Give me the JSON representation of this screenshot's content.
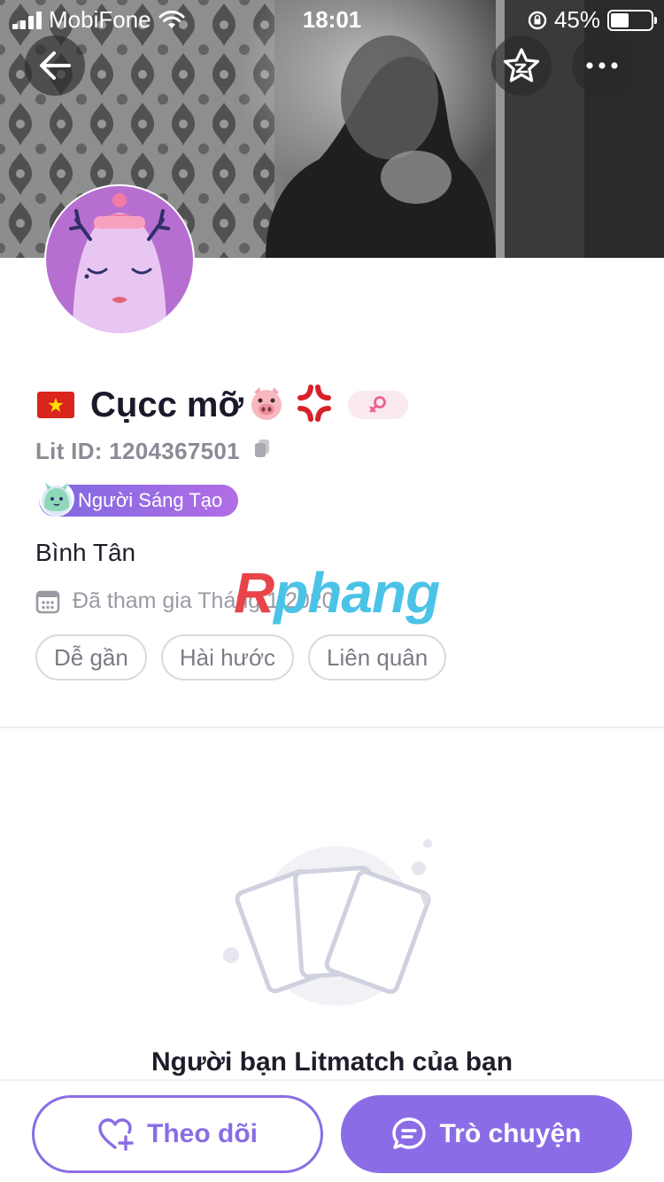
{
  "status_bar": {
    "carrier": "MobiFone",
    "time": "18:01",
    "battery": "45%",
    "battery_level": 0.45
  },
  "header": {
    "back_icon": "arrow-left-icon",
    "favorite_icon": "star-icon",
    "more_icon": "more-horizontal-icon"
  },
  "profile": {
    "flag_icon": "vietnam-flag-icon",
    "name": "Cụcc mỡ",
    "name_emojis": [
      "🐷",
      "💢"
    ],
    "gender_icon": "female-symbol-icon",
    "lit_id": "Lit ID: 1204367501",
    "copy_icon": "copy-icon",
    "creator_badge": "Người Sáng Tạo",
    "location": "Bình Tân",
    "joined": "Đã tham gia Tháng 1 2020",
    "tags": [
      "Dễ gần",
      "Hài hước",
      "Liên quân"
    ]
  },
  "watermark": {
    "first_letter": "R",
    "rest": "phang"
  },
  "empty_state": {
    "icon": "cards-icon",
    "title": "Người bạn Litmatch của bạn"
  },
  "actions": {
    "follow_label": "Theo dõi",
    "chat_label": "Trò chuyện"
  },
  "colors": {
    "accent": "#8a6de6",
    "female_badge_bg": "#fbe9f0",
    "flag_red": "#da251d"
  }
}
